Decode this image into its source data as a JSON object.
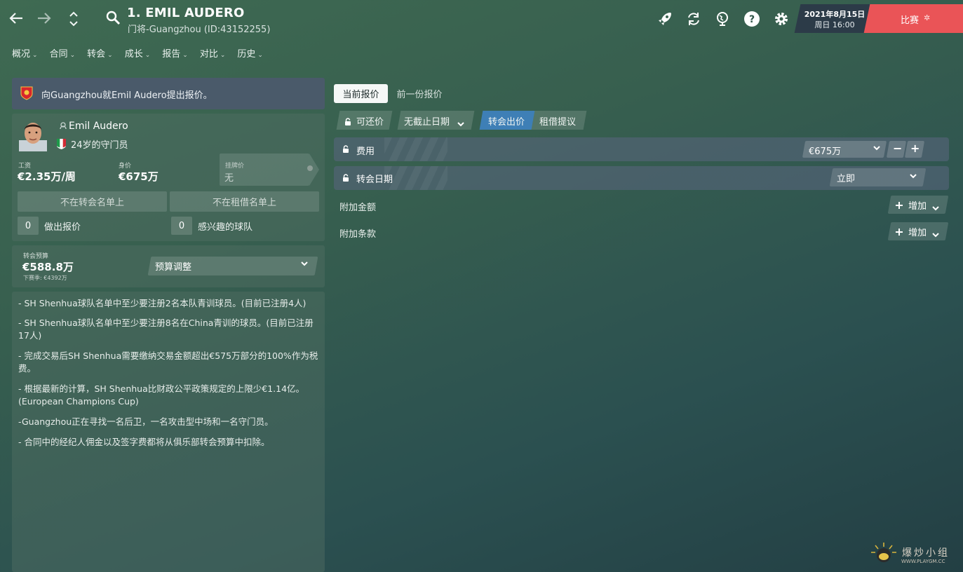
{
  "header": {
    "player_title": "1. EMIL AUDERO",
    "player_subtitle": "门将-Guangzhou (ID:43152255)",
    "date": "2021年8月15日",
    "time": "周日 16:00",
    "match_label": "比赛",
    "icons": [
      "back-arrow-icon",
      "forward-arrow-icon",
      "up-down-icon",
      "search-icon",
      "rocket-icon",
      "refresh-icon",
      "globe-icon",
      "help-icon",
      "gear-icon"
    ]
  },
  "nav": {
    "items": [
      "概况",
      "合同",
      "转会",
      "成长",
      "报告",
      "对比",
      "历史"
    ]
  },
  "notice": {
    "text": "向Guangzhou就Emil Audero提出报价。"
  },
  "player": {
    "name": "Emil Audero",
    "age_position": "24岁的守门员",
    "wage_label": "工资",
    "wage": "€2.35万/周",
    "value_label": "身价",
    "value": "€675万",
    "asking_label": "挂牌价",
    "asking_value": "无",
    "transfer_list": "不在转会名单上",
    "loan_list": "不在租借名单上",
    "offers_count": "0",
    "offers_label": "做出报价",
    "interested_count": "0",
    "interested_label": "感兴趣的球队"
  },
  "budget": {
    "label": "转会预算",
    "value": "€588.8万",
    "next_season": "下赛季: €4392万",
    "adjust_label": "预算调整"
  },
  "notes": [
    "- SH Shenhua球队名单中至少要注册2名本队青训球员。(目前已注册4人)",
    "- SH Shenhua球队名单中至少要注册8名在China青训的球员。(目前已注册17人)",
    "- 完成交易后SH Shenhua需要缴纳交易金额超出€575万部分的100%作为税费。",
    "- 根据最新的计算，SH Shenhua比财政公平政策规定的上限少€1.14亿。(European Champions Cup)",
    "-Guangzhou正在寻找一名后卫，一名攻击型中场和一名守门员。",
    "- 合同中的经纪人佣金以及签字费都将从俱乐部转会预算中扣除。"
  ],
  "offer": {
    "tab_current": "当前报价",
    "tab_previous": "前一份报价",
    "negotiable": "可还价",
    "deadline": "无截止日期",
    "transfer_offer": "转会出价",
    "loan_offer": "租借提议",
    "fee_label": "费用",
    "fee_value": "€675万",
    "date_label": "转会日期",
    "date_value": "立即",
    "add_fees_label": "附加金额",
    "add_clauses_label": "附加条款",
    "add_button": "增加"
  },
  "watermark": {
    "text": "爆炒小组",
    "url": "WWW.PLAYGM.CC"
  },
  "colors": {
    "match_red": "#ea5457",
    "offer_blue": "#3e7fb6",
    "notice_bg": "#4a5a6a"
  }
}
